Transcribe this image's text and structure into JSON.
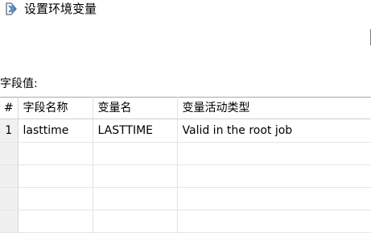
{
  "dialog": {
    "title": "设置环境变量",
    "icon": "set-variable-icon"
  },
  "fields_label": "字段值:",
  "table": {
    "columns": [
      "#",
      "字段名称",
      "变量名",
      "变量活动类型"
    ],
    "rows": [
      {
        "num": "1",
        "field_name": "lasttime",
        "variable_name": "LASTTIME",
        "scope": "Valid in the root job"
      }
    ]
  }
}
